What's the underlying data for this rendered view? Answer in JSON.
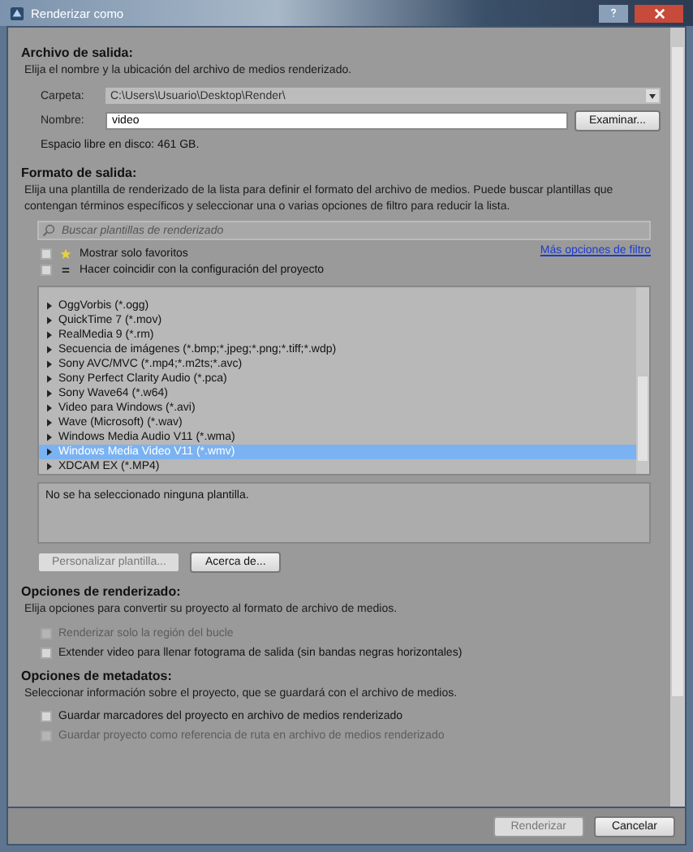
{
  "window": {
    "title": "Renderizar como"
  },
  "output_file": {
    "heading": "Archivo de salida:",
    "description": "Elija el nombre y la ubicación del archivo de medios renderizado.",
    "folder_label": "Carpeta:",
    "folder_value": "C:\\Users\\Usuario\\Desktop\\Render\\",
    "name_label": "Nombre:",
    "name_value": "video",
    "browse_button": "Examinar...",
    "free_space": "Espacio libre en disco: 461 GB."
  },
  "output_format": {
    "heading": "Formato de salida:",
    "description": "Elija una plantilla de renderizado de la lista para definir el formato del archivo de medios. Puede buscar plantillas que contengan términos específicos y seleccionar una o varias opciones de filtro para reducir la lista.",
    "search": {
      "placeholder": "Buscar plantillas de renderizado"
    },
    "filters": [
      {
        "kind": "star",
        "label": "Mostrar solo favoritos",
        "checked": false
      },
      {
        "kind": "equals",
        "label": "Hacer coincidir con la configuración del proyecto",
        "checked": false
      }
    ],
    "more_filters_link": "Más opciones de filtro",
    "templates": [
      {
        "label": "OggVorbis (*.ogg)",
        "selected": false
      },
      {
        "label": "QuickTime 7 (*.mov)",
        "selected": false
      },
      {
        "label": "RealMedia 9 (*.rm)",
        "selected": false
      },
      {
        "label": "Secuencia de imágenes (*.bmp;*.jpeg;*.png;*.tiff;*.wdp)",
        "selected": false
      },
      {
        "label": "Sony AVC/MVC (*.mp4;*.m2ts;*.avc)",
        "selected": false
      },
      {
        "label": "Sony Perfect Clarity Audio (*.pca)",
        "selected": false
      },
      {
        "label": "Sony Wave64 (*.w64)",
        "selected": false
      },
      {
        "label": "Video para Windows (*.avi)",
        "selected": false
      },
      {
        "label": "Wave (Microsoft) (*.wav)",
        "selected": false
      },
      {
        "label": "Windows Media Audio V11 (*.wma)",
        "selected": false
      },
      {
        "label": "Windows Media Video V11 (*.wmv)",
        "selected": true
      },
      {
        "label": "XDCAM EX (*.MP4)",
        "selected": false
      }
    ],
    "template_info": "No se ha seleccionado ninguna plantilla.",
    "buttons": [
      {
        "label": "Personalizar plantilla...",
        "disabled": true
      },
      {
        "label": "Acerca de...",
        "disabled": false
      }
    ]
  },
  "render_options": {
    "heading": "Opciones de renderizado:",
    "description": "Elija opciones para convertir su proyecto al formato de archivo de medios.",
    "options": [
      {
        "label": "Renderizar solo la región del bucle",
        "checked": false,
        "disabled": true
      },
      {
        "label": "Extender video para llenar fotograma de salida (sin bandas negras horizontales)",
        "checked": false,
        "disabled": false
      }
    ]
  },
  "metadata_options": {
    "heading": "Opciones de metadatos:",
    "description": "Seleccionar información sobre el proyecto, que se guardará con el archivo de medios.",
    "options": [
      {
        "label": "Guardar marcadores del proyecto en archivo de medios renderizado",
        "checked": false,
        "disabled": false
      },
      {
        "label": "Guardar proyecto como referencia de ruta en archivo de medios renderizado",
        "checked": false,
        "disabled": true
      }
    ]
  },
  "footer_buttons": [
    {
      "label": "Renderizar",
      "disabled": true
    },
    {
      "label": "Cancelar",
      "disabled": false
    }
  ]
}
